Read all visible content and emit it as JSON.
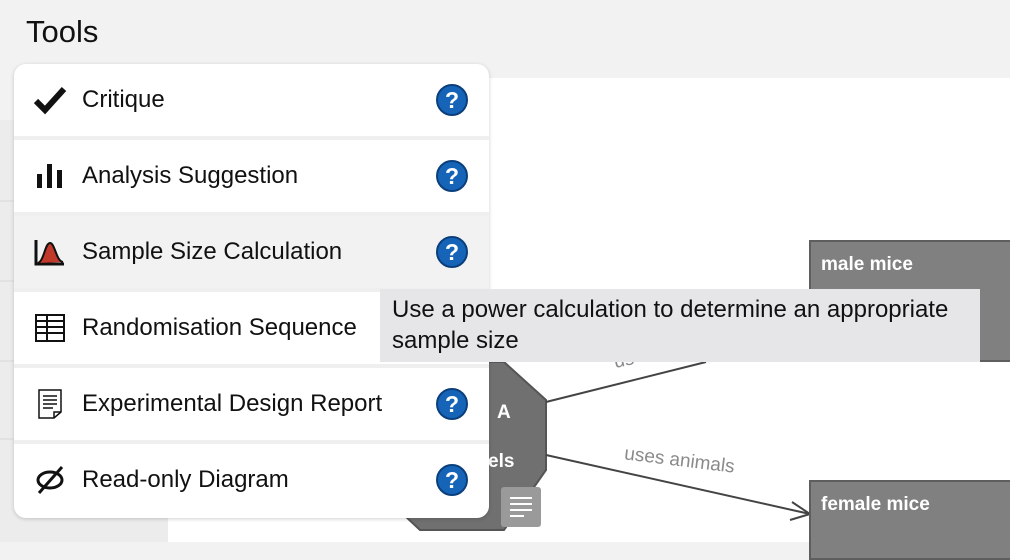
{
  "header": {
    "title": "Tools"
  },
  "tools": [
    {
      "label": "Critique",
      "icon": "checkmark-icon",
      "help": "?"
    },
    {
      "label": "Analysis Suggestion",
      "icon": "bar-chart-icon",
      "help": "?"
    },
    {
      "label": "Sample Size Calculation",
      "icon": "power-curve-icon",
      "help": "?"
    },
    {
      "label": "Randomisation Sequence",
      "icon": "table-icon",
      "help": "?"
    },
    {
      "label": "Experimental Design Report",
      "icon": "document-icon",
      "help": "?"
    },
    {
      "label": "Read-only Diagram",
      "icon": "read-only-icon",
      "help": "?"
    }
  ],
  "tooltip": {
    "text": "Use a power calculation to determine an appropriate sample size"
  },
  "diagram": {
    "nodes": {
      "male": "male mice",
      "female": "female mice"
    },
    "octagon_text": {
      "line1": "A",
      "line2": "els"
    },
    "edges": {
      "top_partial": "us",
      "bottom": "uses animals"
    }
  },
  "colors": {
    "help_blue": "#1564b8",
    "node_gray": "#808080",
    "tooltip_bg": "#e6e6e9"
  }
}
